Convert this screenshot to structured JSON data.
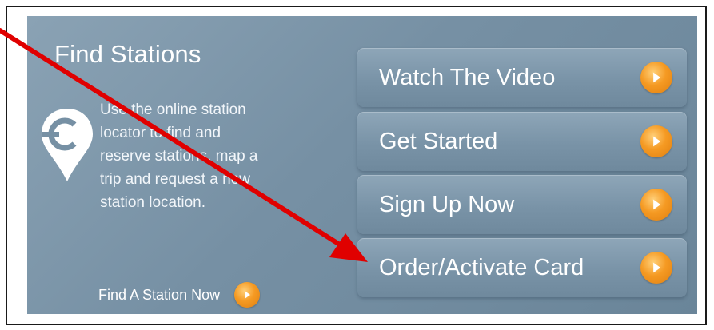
{
  "find_stations": {
    "title": "Find Stations",
    "icon": "station-pin-icon",
    "description_lines": [
      "Use the online station",
      "locator to find and",
      "reserve stations, map a",
      "trip and request a new",
      "station location."
    ],
    "link_label": "Find A Station Now",
    "link_icon": "orange-play-arrow-icon"
  },
  "actions": [
    {
      "label": "Watch The Video",
      "icon": "orange-play-arrow-icon"
    },
    {
      "label": "Get Started",
      "icon": "orange-play-arrow-icon"
    },
    {
      "label": "Sign Up Now",
      "icon": "orange-play-arrow-icon"
    },
    {
      "label": "Order/Activate Card",
      "icon": "orange-play-arrow-icon"
    }
  ],
  "annotation": {
    "icon": "red-arrow-pointer",
    "color": "#e00000"
  },
  "colors": {
    "panel": "#7690a4",
    "accent": "#f59a23",
    "text": "#ffffff"
  }
}
